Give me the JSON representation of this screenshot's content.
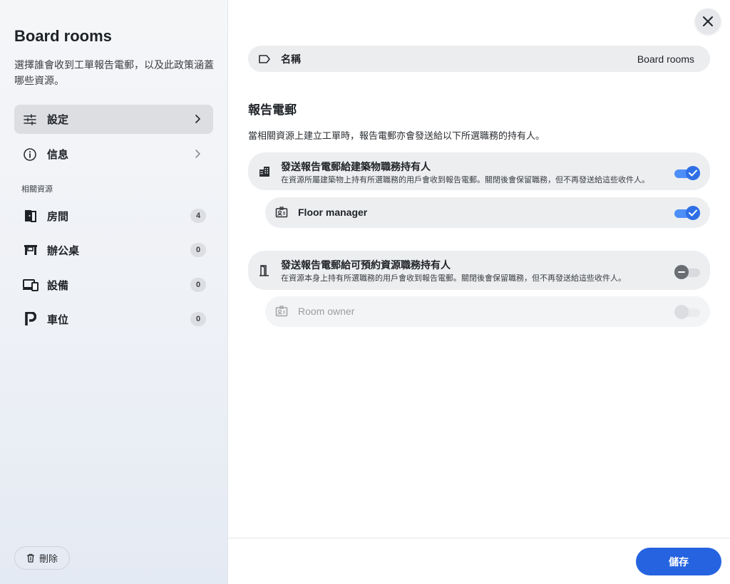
{
  "sidebar": {
    "title": "Board rooms",
    "description": "選擇誰會收到工單報告電郵，以及此政策涵蓋哪些資源。",
    "nav": [
      {
        "label": "設定",
        "icon": "sliders-icon",
        "active": true
      },
      {
        "label": "信息",
        "icon": "info-icon",
        "active": false
      }
    ],
    "resources_label": "相關資源",
    "resources": [
      {
        "label": "房間",
        "icon": "door-icon",
        "count": "4"
      },
      {
        "label": "辦公桌",
        "icon": "desk-icon",
        "count": "0"
      },
      {
        "label": "設備",
        "icon": "devices-icon",
        "count": "0"
      },
      {
        "label": "車位",
        "icon": "parking-icon",
        "count": "0"
      }
    ],
    "delete_label": "刪除"
  },
  "main": {
    "name_field": {
      "label": "名稱",
      "value": "Board rooms"
    },
    "section_title": "報告電郵",
    "section_desc": "當相關資源上建立工單時，報告電郵亦會發送給以下所選職務的持有人。",
    "building_group": {
      "title": "發送報告電郵給建築物職務持有人",
      "subtitle": "在資源所屬建築物上持有所選職務的用戶會收到報告電郵。關閉後會保留職務，但不再發送給這些收件人。",
      "enabled": true,
      "role": {
        "label": "Floor manager",
        "enabled": true
      }
    },
    "resource_group": {
      "title": "發送報告電郵給可預約資源職務持有人",
      "subtitle": "在資源本身上持有所選職務的用戶會收到報告電郵。關閉後會保留職務，但不再發送給這些收件人。",
      "enabled": false,
      "role": {
        "label": "Room owner",
        "enabled": false
      }
    },
    "save_label": "儲存"
  },
  "colors": {
    "accent": "#2563e0",
    "toggle_on": "#2e6fe6",
    "sidebar_bg": "#eef1f6"
  }
}
